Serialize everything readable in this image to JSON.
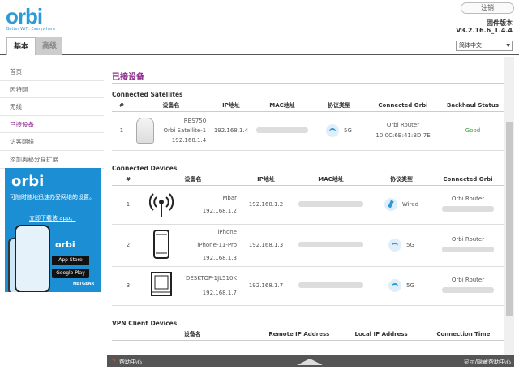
{
  "header": {
    "logo": "orbi",
    "tagline": "Better WiFi. Everywhere",
    "logout_label": "注销",
    "firmware_label": "固件版本",
    "firmware_version": "V3.2.16.6_1.4.4",
    "language": "简体中文"
  },
  "tabs": [
    {
      "label": "基本"
    },
    {
      "label": "高级"
    }
  ],
  "sidebar": {
    "items": [
      {
        "label": "首页"
      },
      {
        "label": "因特网"
      },
      {
        "label": "无线"
      },
      {
        "label": "已接设备"
      },
      {
        "label": "访客网络"
      },
      {
        "label": "添加奥秘分身扩展"
      }
    ],
    "active_index": 3
  },
  "promo": {
    "logo": "orbi",
    "text": "可随时随地迅速办妥网络的设置。",
    "link": "立即下载该 app。",
    "app_logo": "orbi",
    "app_store": "App Store",
    "google_play": "Google Play",
    "brand": "NETGEAR"
  },
  "main": {
    "title": "已接设备",
    "satellites": {
      "heading": "Connected Satellites",
      "columns": [
        "#",
        "设备名",
        "IP地址",
        "MAC地址",
        "协议类型",
        "Connected Orbi",
        "Backhaul Status"
      ],
      "rows": [
        {
          "num": "1",
          "name1": "RBS750",
          "name2": "Orbi Satellite-1",
          "name3": "192.168.1.4",
          "ip": "192.168.1.4",
          "proto": "5G",
          "orbi1": "Orbi Router",
          "orbi2": "10:0C:6B:41:BD:7E",
          "status": "Good"
        }
      ]
    },
    "devices": {
      "heading": "Connected Devices",
      "columns": [
        "#",
        "设备名",
        "IP地址",
        "MAC地址",
        "协议类型",
        "Connected Orbi"
      ],
      "rows": [
        {
          "num": "1",
          "name": "Mbar",
          "ip_sub": "192.168.1.2",
          "ip": "192.168.1.2",
          "proto": "Wired",
          "orbi": "Orbi Router"
        },
        {
          "num": "2",
          "name": "iPhone",
          "name2": "iPhone-11-Pro",
          "ip_sub": "192.168.1.3",
          "ip": "192.168.1.3",
          "proto": "5G",
          "orbi": "Orbi Router"
        },
        {
          "num": "3",
          "name": "DESKTOP-1JL510K",
          "ip_sub": "192.168.1.7",
          "ip": "192.168.1.7",
          "proto": "5G",
          "orbi": "Orbi Router"
        }
      ]
    },
    "vpn": {
      "heading": "VPN Client Devices",
      "columns": [
        "设备名",
        "Remote IP Address",
        "Local IP Address",
        "Connection Time"
      ]
    }
  },
  "footer": {
    "help": "帮助中心",
    "toggle": "显示/隐藏帮助中心"
  }
}
